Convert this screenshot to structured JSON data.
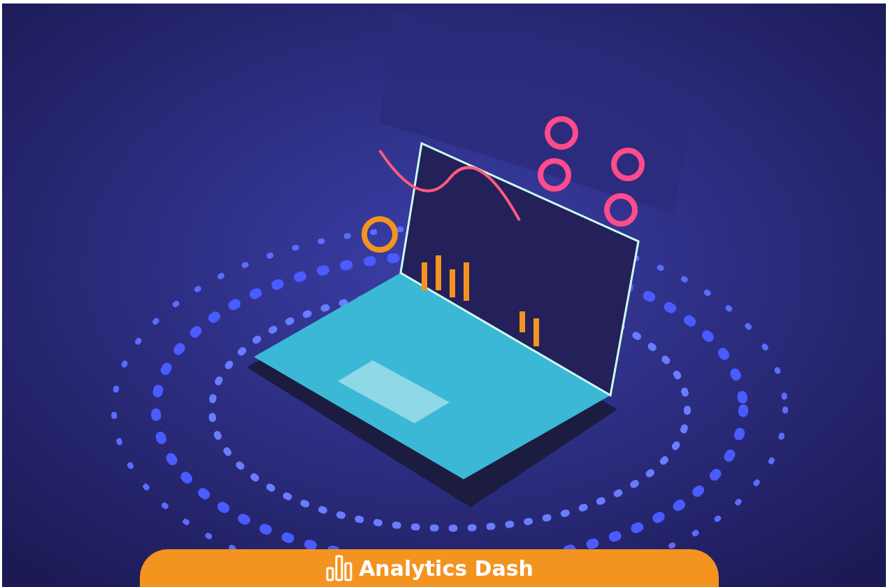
{
  "cta_button": {
    "label": "Analytics Dash"
  }
}
